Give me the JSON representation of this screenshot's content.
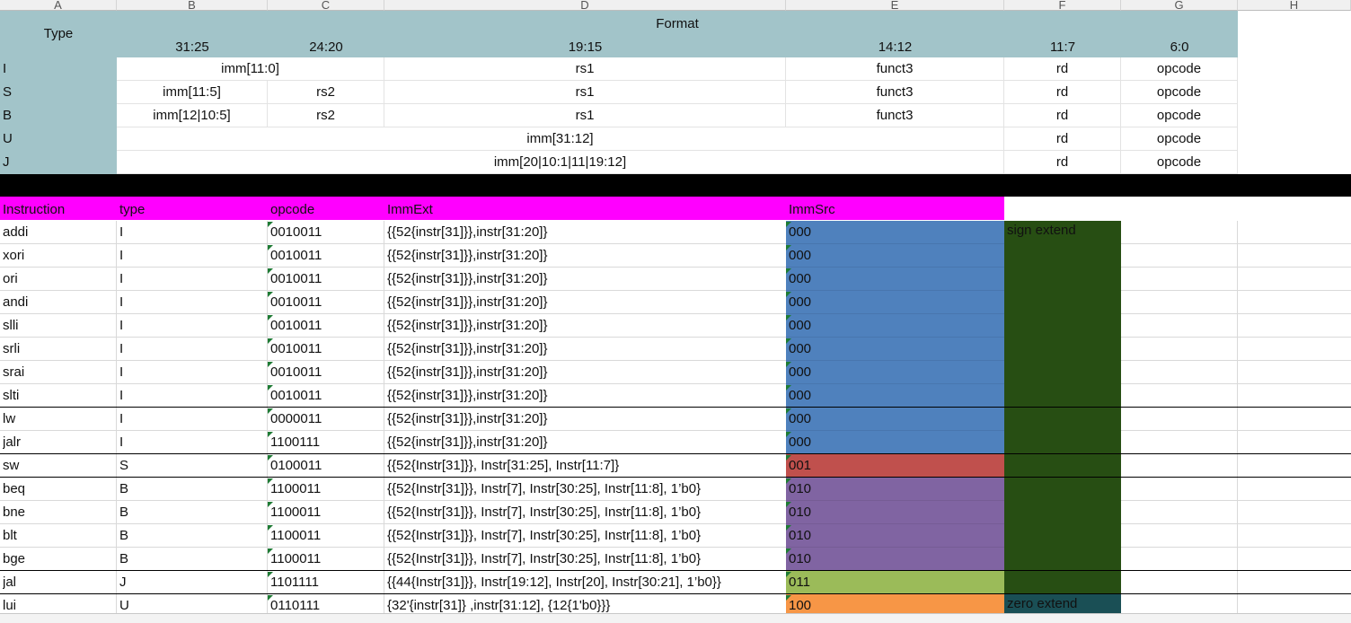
{
  "columns": [
    "A",
    "B",
    "C",
    "D",
    "E",
    "F",
    "G",
    "H"
  ],
  "format_table": {
    "type_label": "Type",
    "format_label": "Format",
    "bit_ranges": [
      "31:25",
      "24:20",
      "19:15",
      "14:12",
      "11:7",
      "6:0"
    ],
    "rows": [
      {
        "type": "I",
        "cells": [
          "imm[11:0]",
          "rs1",
          "funct3",
          "rd",
          "opcode"
        ]
      },
      {
        "type": "S",
        "cells": [
          "imm[11:5]",
          "rs2",
          "rs1",
          "funct3",
          "rd",
          "opcode"
        ]
      },
      {
        "type": "B",
        "cells": [
          "imm[12|10:5]",
          "rs2",
          "rs1",
          "funct3",
          "rd",
          "opcode"
        ]
      },
      {
        "type": "U",
        "cells": [
          "imm[31:12]",
          "rd",
          "opcode"
        ]
      },
      {
        "type": "J",
        "cells": [
          "imm[20|10:1|11|19:12]",
          "rd",
          "opcode"
        ]
      }
    ]
  },
  "inst_table": {
    "headers": [
      "Instruction",
      "type",
      "opcode",
      "ImmExt",
      "ImmSrc"
    ],
    "rows": [
      {
        "name": "addi",
        "type": "I",
        "opcode": "0010011",
        "immext": "{{52{instr[31]}},instr[31:20]}",
        "immsrc": "000"
      },
      {
        "name": "xori",
        "type": "I",
        "opcode": "0010011",
        "immext": "{{52{instr[31]}},instr[31:20]}",
        "immsrc": "000"
      },
      {
        "name": "ori",
        "type": "I",
        "opcode": "0010011",
        "immext": "{{52{instr[31]}},instr[31:20]}",
        "immsrc": "000"
      },
      {
        "name": "andi",
        "type": "I",
        "opcode": "0010011",
        "immext": "{{52{instr[31]}},instr[31:20]}",
        "immsrc": "000"
      },
      {
        "name": "slli",
        "type": "I",
        "opcode": "0010011",
        "immext": "{{52{instr[31]}},instr[31:20]}",
        "immsrc": "000"
      },
      {
        "name": "srli",
        "type": "I",
        "opcode": "0010011",
        "immext": "{{52{instr[31]}},instr[31:20]}",
        "immsrc": "000"
      },
      {
        "name": "srai",
        "type": "I",
        "opcode": "0010011",
        "immext": "{{52{instr[31]}},instr[31:20]}",
        "immsrc": "000"
      },
      {
        "name": "slti",
        "type": "I",
        "opcode": "0010011",
        "immext": "{{52{instr[31]}},instr[31:20]}",
        "immsrc": "000"
      },
      {
        "name": "lw",
        "type": "I",
        "opcode": "0000011",
        "immext": "{{52{instr[31]}},instr[31:20]}",
        "immsrc": "000"
      },
      {
        "name": "jalr",
        "type": "I",
        "opcode": "1100111",
        "immext": "{{52{instr[31]}},instr[31:20]}",
        "immsrc": "000"
      },
      {
        "name": "sw",
        "type": "S",
        "opcode": "0100011",
        "immext": "{{52{Instr[31]}}, Instr[31:25], Instr[11:7]}",
        "immsrc": "001"
      },
      {
        "name": "beq",
        "type": "B",
        "opcode": "1100011",
        "immext": "{{52{Instr[31]}}, Instr[7], Instr[30:25], Instr[11:8], 1’b0}",
        "immsrc": "010"
      },
      {
        "name": "bne",
        "type": "B",
        "opcode": "1100011",
        "immext": "{{52{Instr[31]}}, Instr[7], Instr[30:25], Instr[11:8], 1’b0}",
        "immsrc": "010"
      },
      {
        "name": "blt",
        "type": "B",
        "opcode": "1100011",
        "immext": "{{52{Instr[31]}}, Instr[7], Instr[30:25], Instr[11:8], 1’b0}",
        "immsrc": "010"
      },
      {
        "name": "bge",
        "type": "B",
        "opcode": "1100011",
        "immext": "{{52{Instr[31]}}, Instr[7], Instr[30:25], Instr[11:8], 1’b0}",
        "immsrc": "010"
      },
      {
        "name": "jal",
        "type": "J",
        "opcode": "1101111",
        "immext": "{{44{Instr[31]}}, Instr[19:12], Instr[20], Instr[30:21], 1’b0}}",
        "immsrc": "011"
      },
      {
        "name": "lui",
        "type": "U",
        "opcode": "0110111",
        "immext": "{32'{instr[31]} ,instr[31:12], {12{1'b0}}}",
        "immsrc": "100"
      }
    ],
    "notes": {
      "sign": "sign extend",
      "zero": "zero extend"
    }
  },
  "colors": {
    "teal": "#a2c4c9",
    "magenta": "#ff00ff",
    "blue": "#4f81bd",
    "red": "#c0504d",
    "purple": "#8064a2",
    "green": "#9bbb59",
    "orange": "#f79646",
    "dark_green": "#274e13",
    "dark_teal": "#1a4f55"
  }
}
